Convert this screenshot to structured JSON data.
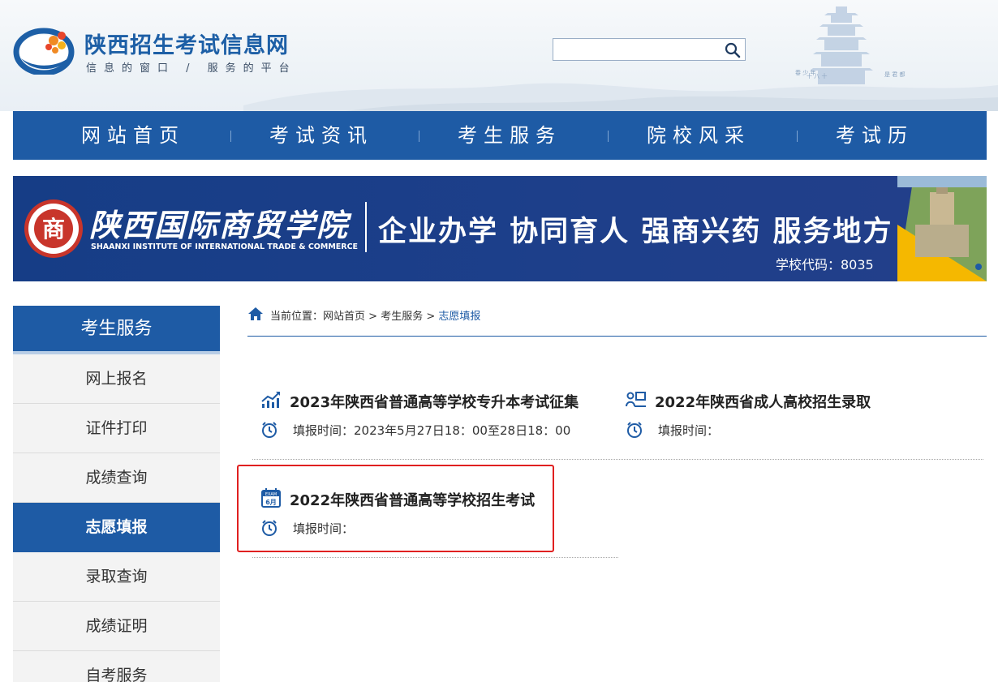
{
  "header": {
    "site_title": "陕西招生考试信息网",
    "slogan": "信息的窗口 / 服务的平台",
    "search": {
      "value": "",
      "placeholder": ""
    }
  },
  "nav": {
    "items": [
      "网站首页",
      "考试资讯",
      "考生服务",
      "院校风采",
      "考试历"
    ]
  },
  "banner": {
    "school_name": "陕西国际商贸学院",
    "school_name_en": "SHAANXI INSTITUTE OF INTERNATIONAL TRADE & COMMERCE",
    "slogan": "企业办学 协同育人 强商兴药 服务地方",
    "school_code": "学校代码：8035",
    "emblem_char": "商"
  },
  "sidebar": {
    "title": "考生服务",
    "items": [
      "网上报名",
      "证件打印",
      "成绩查询",
      "志愿填报",
      "录取查询",
      "成绩证明",
      "自考服务"
    ],
    "active_index": 3
  },
  "breadcrumb": {
    "prefix": "当前位置：",
    "home": "网站首页",
    "sep": ">",
    "section": "考生服务",
    "current": "志愿填报"
  },
  "cards": [
    {
      "title": "2023年陕西省普通高等学校专升本考试征集",
      "time": "填报时间：2023年5月27日18：00至28日18：00",
      "icon": "chart-up-icon"
    },
    {
      "title": "2022年陕西省成人高校招生录取",
      "time": "填报时间：",
      "icon": "people-board-icon"
    },
    {
      "title": "2022年陕西省普通高等学校招生考试",
      "time": "填报时间：",
      "icon": "exam-calendar-icon",
      "icon_text": "EXAM",
      "icon_month": "6月"
    }
  ],
  "colors": {
    "primary": "#1e5ba5",
    "highlight": "#e02020",
    "banner": "#1d3f8a",
    "banner_accent": "#f5b800"
  }
}
